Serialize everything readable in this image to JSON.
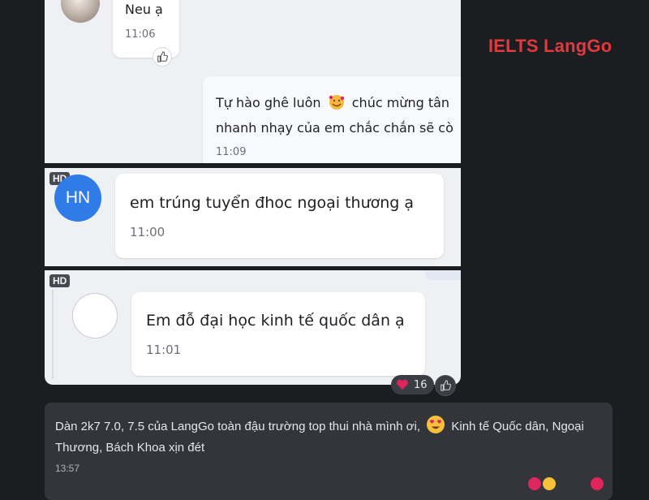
{
  "brand": {
    "part1": "IELTS ",
    "part2": "LangGo"
  },
  "screenshots": [
    {
      "messages": [
        {
          "text": "Neu ạ",
          "time": "11:06",
          "side": "left",
          "avatar": "photo-avatar"
        },
        {
          "text_line1_a": "Tự hào ghê luôn",
          "text_line1_b": "chúc mừng tân",
          "text_line2": "nhanh nhạy của em chắc chắn sẽ cò",
          "time": "11:09",
          "side": "right",
          "emoji": "smiling-face-with-hearts-icon"
        }
      ]
    },
    {
      "badge": "HD",
      "avatar_initials": "HN",
      "messages": [
        {
          "text": "em trúng tuyển đhoc ngoại thương ạ",
          "time": "11:00",
          "side": "left"
        }
      ]
    },
    {
      "badge": "HD",
      "messages": [
        {
          "text": "Em đỗ đại học kinh tế quốc dân ạ",
          "time": "11:01",
          "side": "left"
        }
      ],
      "reaction": {
        "icon": "heart-icon",
        "count": "16"
      }
    }
  ],
  "comment": {
    "text_part1": "Dàn 2k7 7.0, 7.5 của LangGo toàn đậu trường top thui nhà mình ơi,",
    "emoji": "heart-eyes-icon",
    "text_part2": "Kinh tế Quốc dân, Ngoại Thương, Bách Khoa xịn đét",
    "time": "13:57"
  },
  "colors": {
    "background": "#1c1d21",
    "brand": "#e03a3e",
    "chat_panel": "#eef0f4",
    "comment_bubble": "#33353b",
    "avatar_hn": "#2f7be8"
  }
}
